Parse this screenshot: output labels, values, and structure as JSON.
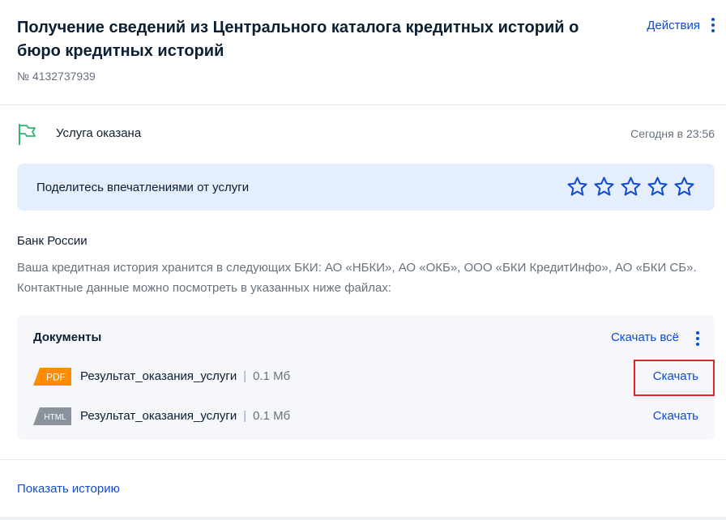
{
  "header": {
    "title": "Получение сведений из Центрального каталога кредитных историй о бюро кредитных историй",
    "order_number": "№ 4132737939",
    "actions_label": "Действия"
  },
  "status": {
    "icon": "flag-icon",
    "text": "Услуга оказана",
    "time": "Сегодня в 23:56"
  },
  "feedback": {
    "prompt": "Поделитесь впечатлениями от услуги",
    "rating": 0,
    "max_rating": 5
  },
  "message": {
    "organization": "Банк России",
    "body": "Ваша кредитная история хранится в следующих БКИ: АО «НБКИ», АО «ОКБ», ООО «БКИ КредитИнфо», АО «БКИ СБ». Контактные данные можно посмотреть в указанных ниже файлах:"
  },
  "documents": {
    "title": "Документы",
    "download_all_label": "Скачать всё",
    "items": [
      {
        "type": "PDF",
        "badge_color": "#ff8c00",
        "name": "Результат_оказания_услуги",
        "separator": "|",
        "size": "0.1 Мб",
        "download_label": "Скачать"
      },
      {
        "type": "HTML",
        "badge_color": "#8a939c",
        "name": "Результат_оказания_услуги",
        "separator": "|",
        "size": "0.1 Мб",
        "download_label": "Скачать"
      }
    ]
  },
  "footer": {
    "history_link": "Показать историю"
  },
  "colors": {
    "accent": "#0d4cd3",
    "status_green": "#2fb56a",
    "feedback_bg": "#e5eefc",
    "highlight": "#e0252b"
  }
}
